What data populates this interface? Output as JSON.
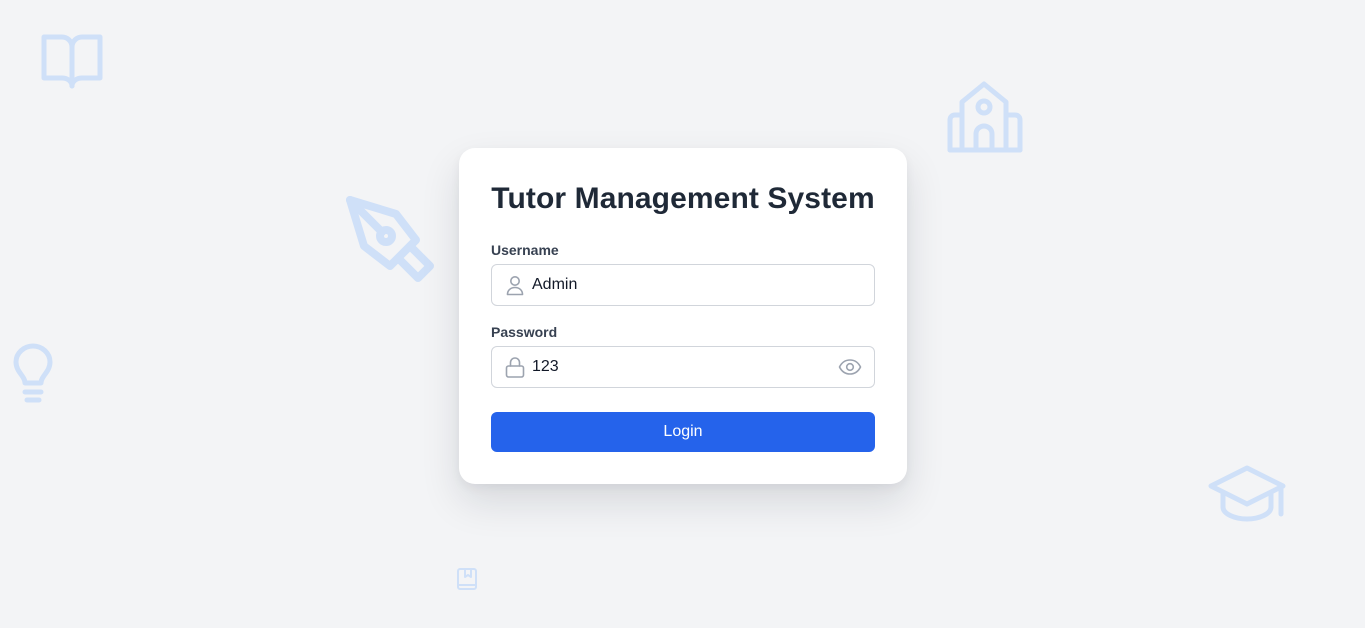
{
  "login": {
    "title": "Tutor Management System",
    "username": {
      "label": "Username",
      "value": "Admin"
    },
    "password": {
      "label": "Password",
      "value": "123"
    },
    "submit_label": "Login"
  },
  "icons": {
    "username": "user-icon",
    "password": "lock-icon",
    "toggle_password": "eye-icon",
    "background": [
      "book-open-icon",
      "school-icon",
      "pen-tool-icon",
      "lightbulb-icon",
      "graduation-cap-icon",
      "notebook-icon"
    ]
  },
  "colors": {
    "background": "#f3f4f6",
    "card": "#ffffff",
    "primary": "#2563eb",
    "title": "#1f2937",
    "decorative_icon": "#cfe0f8",
    "input_border": "#d1d5db",
    "input_icon": "#9ca3af"
  }
}
